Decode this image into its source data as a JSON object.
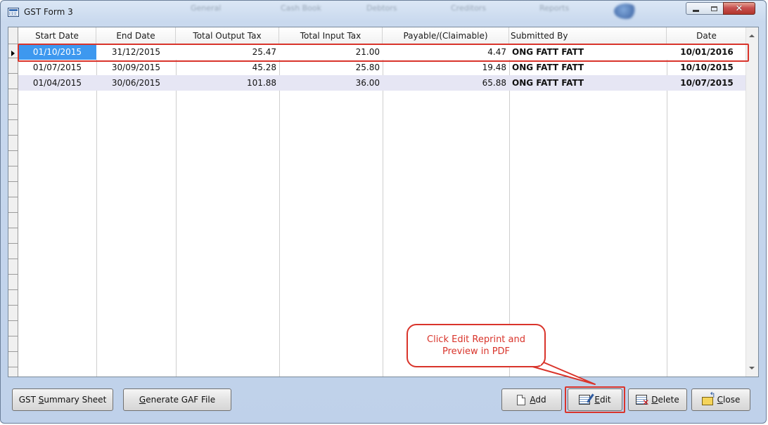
{
  "window": {
    "title": "GST Form 3"
  },
  "menu_ghost": [
    "General",
    "Cash Book",
    "Debtors",
    "Creditors",
    "Reports"
  ],
  "table": {
    "columns": [
      "Start Date",
      "End Date",
      "Total Output Tax",
      "Total Input Tax",
      "Payable/(Claimable)",
      "Submitted By",
      "Date"
    ],
    "rows": [
      [
        "01/10/2015",
        "31/12/2015",
        "25.47",
        "21.00",
        "4.47",
        "ONG FATT FATT",
        "10/01/2016"
      ],
      [
        "01/07/2015",
        "30/09/2015",
        "45.28",
        "25.80",
        "19.48",
        "ONG FATT FATT",
        "10/10/2015"
      ],
      [
        "01/04/2015",
        "30/06/2015",
        "101.88",
        "36.00",
        "65.88",
        "ONG FATT FATT",
        "10/07/2015"
      ]
    ],
    "selected_row": 0
  },
  "buttons": {
    "gst_summary": {
      "prefix": "GST ",
      "accel": "S",
      "suffix": "ummary Sheet"
    },
    "generate_gaf": {
      "prefix": "",
      "accel": "G",
      "suffix": "enerate GAF File"
    },
    "add": {
      "accel": "A",
      "suffix": "dd"
    },
    "edit": {
      "accel": "E",
      "suffix": "dit"
    },
    "delete": {
      "accel": "D",
      "suffix": "elete"
    },
    "close": {
      "accel": "C",
      "suffix": "lose"
    }
  },
  "callout": {
    "text": "Click Edit Reprint and Preview in PDF"
  },
  "colors": {
    "annotation_red": "#d9342b",
    "selection_blue": "#3d98ef",
    "alt_row": "#e6e6f4"
  },
  "icons": [
    "grid-window-icon",
    "minimize-icon",
    "maximize-icon",
    "close-icon",
    "document-icon",
    "edit-icon",
    "delete-icon",
    "folder-close-icon"
  ]
}
